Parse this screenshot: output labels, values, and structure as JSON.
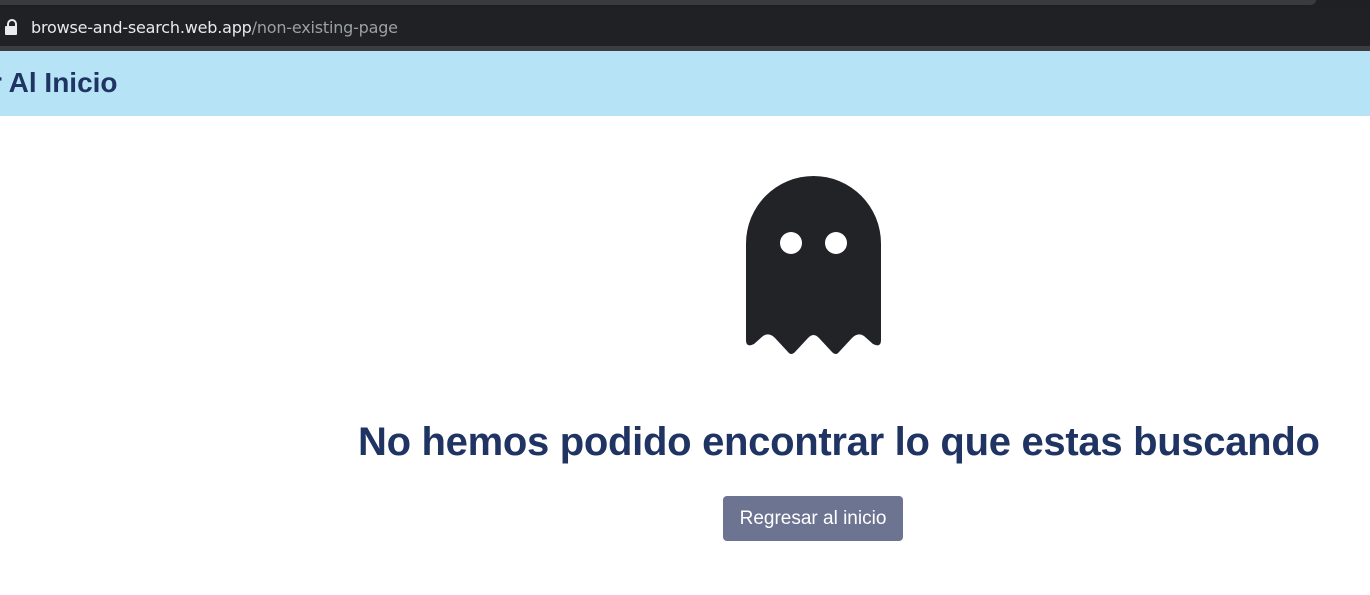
{
  "browser": {
    "url_domain": "browse-and-search.web.app",
    "url_path": "/non-existing-page"
  },
  "navbar": {
    "link_label": "r Al Inicio"
  },
  "main": {
    "icon": "ghost-icon",
    "heading": "No hemos podido encontrar lo que estas buscando",
    "button_label": "Regresar al inicio"
  },
  "colors": {
    "navbar_bg": "#b7e3f7",
    "heading": "#1f3462",
    "button_bg": "#6c7492",
    "ghost": "#212327"
  }
}
